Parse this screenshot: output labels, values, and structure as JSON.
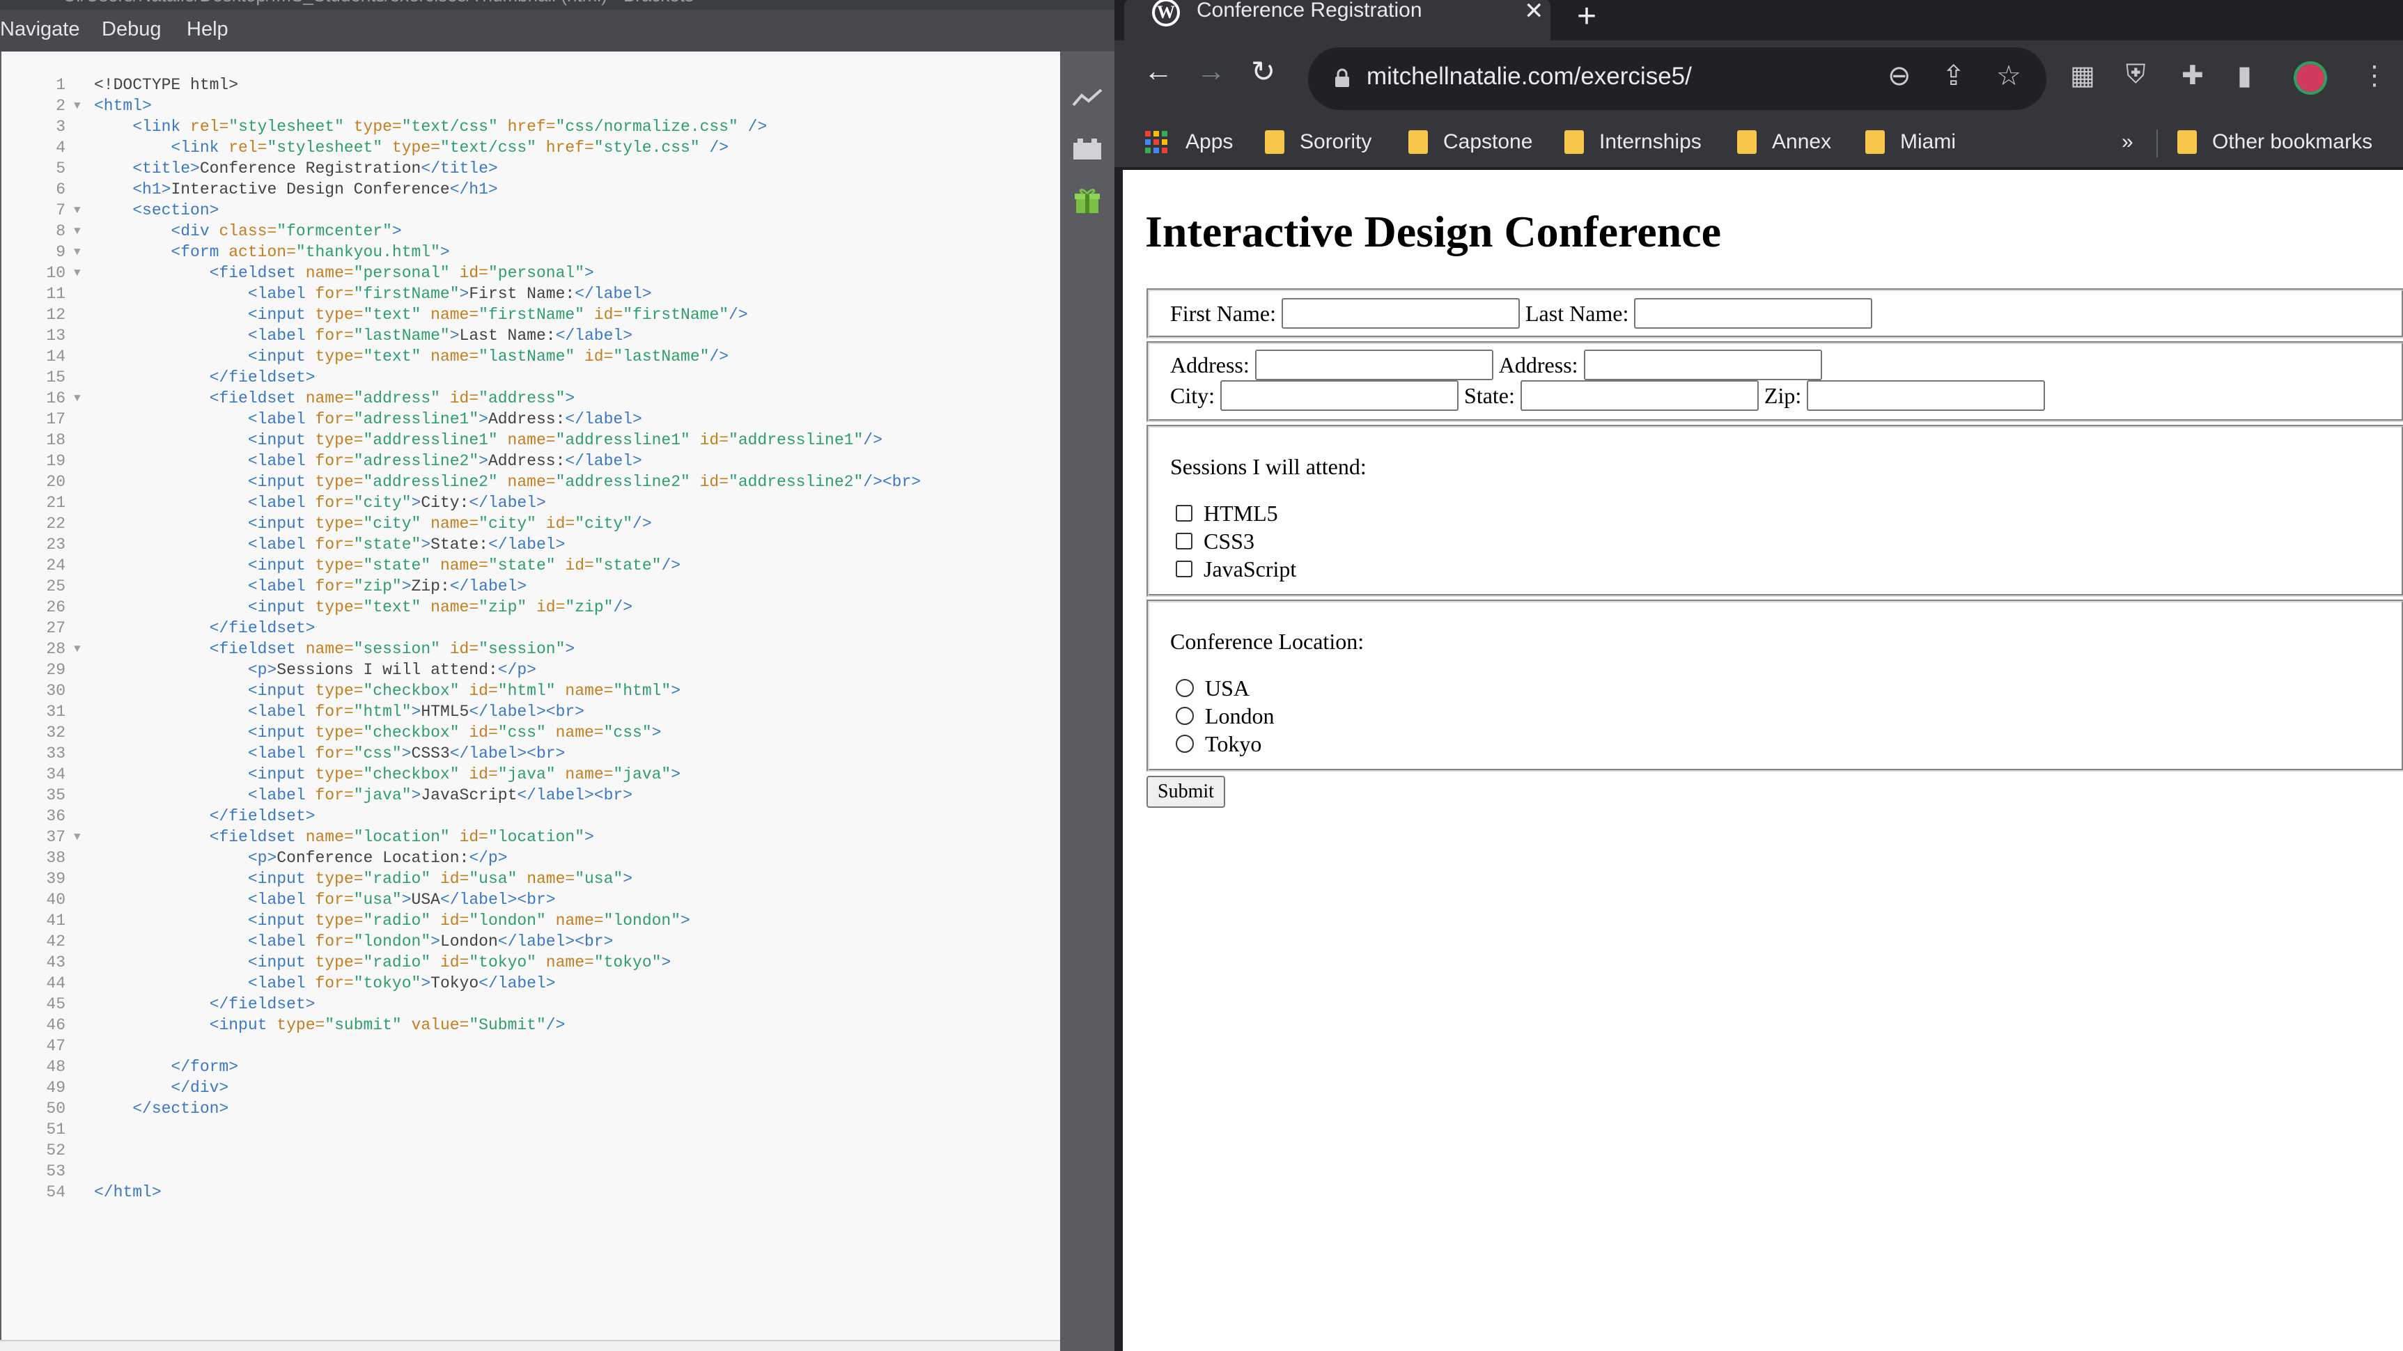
{
  "editor": {
    "title": "C:/Users/Natalie/Desktop/IMS_Students/exercises/Thumbnail (html) - Brackets",
    "menu": [
      "Navigate",
      "Debug",
      "Help"
    ],
    "lines": [
      {
        "n": "1",
        "fold": "",
        "html": "<span class='x'>&lt;!DOCTYPE html&gt;</span>"
      },
      {
        "n": "2",
        "fold": "▼",
        "html": "<span class='t'>&lt;html&gt;</span>"
      },
      {
        "n": "3",
        "fold": "",
        "html": "    <span class='t'>&lt;link</span> <span class='a'>rel=</span><span class='v'>\"stylesheet\"</span> <span class='a'>type=</span><span class='v'>\"text/css\"</span> <span class='a'>href=</span><span class='v'>\"css/normalize.css\"</span> <span class='t'>/&gt;</span>"
      },
      {
        "n": "4",
        "fold": "",
        "html": "        <span class='t'>&lt;link</span> <span class='a'>rel=</span><span class='v'>\"stylesheet\"</span> <span class='a'>type=</span><span class='v'>\"text/css\"</span> <span class='a'>href=</span><span class='v'>\"style.css\"</span> <span class='t'>/&gt;</span>"
      },
      {
        "n": "5",
        "fold": "",
        "html": "    <span class='t'>&lt;title&gt;</span><span class='x'>Conference Registration</span><span class='t'>&lt;/title&gt;</span>"
      },
      {
        "n": "6",
        "fold": "",
        "html": "    <span class='t'>&lt;h1&gt;</span><span class='x'>Interactive Design Conference</span><span class='t'>&lt;/h1&gt;</span>"
      },
      {
        "n": "7",
        "fold": "▼",
        "html": "    <span class='t'>&lt;section&gt;</span>"
      },
      {
        "n": "8",
        "fold": "▼",
        "html": "        <span class='t'>&lt;div</span> <span class='a'>class=</span><span class='v'>\"formcenter\"</span><span class='t'>&gt;</span>"
      },
      {
        "n": "9",
        "fold": "▼",
        "html": "        <span class='t'>&lt;form</span> <span class='a'>action=</span><span class='v'>\"thankyou.html\"</span><span class='t'>&gt;</span>"
      },
      {
        "n": "10",
        "fold": "▼",
        "html": "            <span class='t'>&lt;fieldset</span> <span class='a'>name=</span><span class='v'>\"personal\"</span> <span class='a'>id=</span><span class='v'>\"personal\"</span><span class='t'>&gt;</span>"
      },
      {
        "n": "11",
        "fold": "",
        "html": "                <span class='t'>&lt;label</span> <span class='a'>for=</span><span class='v'>\"firstName\"</span><span class='t'>&gt;</span><span class='x'>First Name:</span><span class='t'>&lt;/label&gt;</span>"
      },
      {
        "n": "12",
        "fold": "",
        "html": "                <span class='t'>&lt;input</span> <span class='a'>type=</span><span class='v'>\"text\"</span> <span class='a'>name=</span><span class='v'>\"firstName\"</span> <span class='a'>id=</span><span class='v'>\"firstName\"</span><span class='t'>/&gt;</span>"
      },
      {
        "n": "13",
        "fold": "",
        "html": "                <span class='t'>&lt;label</span> <span class='a'>for=</span><span class='v'>\"lastName\"</span><span class='t'>&gt;</span><span class='x'>Last Name:</span><span class='t'>&lt;/label&gt;</span>"
      },
      {
        "n": "14",
        "fold": "",
        "html": "                <span class='t'>&lt;input</span> <span class='a'>type=</span><span class='v'>\"text\"</span> <span class='a'>name=</span><span class='v'>\"lastName\"</span> <span class='a'>id=</span><span class='v'>\"lastName\"</span><span class='t'>/&gt;</span>"
      },
      {
        "n": "15",
        "fold": "",
        "html": "            <span class='t'>&lt;/fieldset&gt;</span>"
      },
      {
        "n": "16",
        "fold": "▼",
        "html": "            <span class='t'>&lt;fieldset</span> <span class='a'>name=</span><span class='v'>\"address\"</span> <span class='a'>id=</span><span class='v'>\"address\"</span><span class='t'>&gt;</span>"
      },
      {
        "n": "17",
        "fold": "",
        "html": "                <span class='t'>&lt;label</span> <span class='a'>for=</span><span class='v'>\"adressline1\"</span><span class='t'>&gt;</span><span class='x'>Address:</span><span class='t'>&lt;/label&gt;</span>"
      },
      {
        "n": "18",
        "fold": "",
        "html": "                <span class='t'>&lt;input</span> <span class='a'>type=</span><span class='v'>\"addressline1\"</span> <span class='a'>name=</span><span class='v'>\"addressline1\"</span> <span class='a'>id=</span><span class='v'>\"addressline1\"</span><span class='t'>/&gt;</span>"
      },
      {
        "n": "19",
        "fold": "",
        "html": "                <span class='t'>&lt;label</span> <span class='a'>for=</span><span class='v'>\"adressline2\"</span><span class='t'>&gt;</span><span class='x'>Address:</span><span class='t'>&lt;/label&gt;</span>"
      },
      {
        "n": "20",
        "fold": "",
        "html": "                <span class='t'>&lt;input</span> <span class='a'>type=</span><span class='v'>\"addressline2\"</span> <span class='a'>name=</span><span class='v'>\"addressline2\"</span> <span class='a'>id=</span><span class='v'>\"addressline2\"</span><span class='t'>/&gt;&lt;br&gt;</span>"
      },
      {
        "n": "21",
        "fold": "",
        "html": "                <span class='t'>&lt;label</span> <span class='a'>for=</span><span class='v'>\"city\"</span><span class='t'>&gt;</span><span class='x'>City:</span><span class='t'>&lt;/label&gt;</span>"
      },
      {
        "n": "22",
        "fold": "",
        "html": "                <span class='t'>&lt;input</span> <span class='a'>type=</span><span class='v'>\"city\"</span> <span class='a'>name=</span><span class='v'>\"city\"</span> <span class='a'>id=</span><span class='v'>\"city\"</span><span class='t'>/&gt;</span>"
      },
      {
        "n": "23",
        "fold": "",
        "html": "                <span class='t'>&lt;label</span> <span class='a'>for=</span><span class='v'>\"state\"</span><span class='t'>&gt;</span><span class='x'>State:</span><span class='t'>&lt;/label&gt;</span>"
      },
      {
        "n": "24",
        "fold": "",
        "html": "                <span class='t'>&lt;input</span> <span class='a'>type=</span><span class='v'>\"state\"</span> <span class='a'>name=</span><span class='v'>\"state\"</span> <span class='a'>id=</span><span class='v'>\"state\"</span><span class='t'>/&gt;</span>"
      },
      {
        "n": "25",
        "fold": "",
        "html": "                <span class='t'>&lt;label</span> <span class='a'>for=</span><span class='v'>\"zip\"</span><span class='t'>&gt;</span><span class='x'>Zip:</span><span class='t'>&lt;/label&gt;</span>"
      },
      {
        "n": "26",
        "fold": "",
        "html": "                <span class='t'>&lt;input</span> <span class='a'>type=</span><span class='v'>\"text\"</span> <span class='a'>name=</span><span class='v'>\"zip\"</span> <span class='a'>id=</span><span class='v'>\"zip\"</span><span class='t'>/&gt;</span>"
      },
      {
        "n": "27",
        "fold": "",
        "html": "            <span class='t'>&lt;/fieldset&gt;</span>"
      },
      {
        "n": "28",
        "fold": "▼",
        "html": "            <span class='t'>&lt;fieldset</span> <span class='a'>name=</span><span class='v'>\"session\"</span> <span class='a'>id=</span><span class='v'>\"session\"</span><span class='t'>&gt;</span>"
      },
      {
        "n": "29",
        "fold": "",
        "html": "                <span class='t'>&lt;p&gt;</span><span class='x'>Sessions I will attend:</span><span class='t'>&lt;/p&gt;</span>"
      },
      {
        "n": "30",
        "fold": "",
        "html": "                <span class='t'>&lt;input</span> <span class='a'>type=</span><span class='v'>\"checkbox\"</span> <span class='a'>id=</span><span class='v'>\"html\"</span> <span class='a'>name=</span><span class='v'>\"html\"</span><span class='t'>&gt;</span>"
      },
      {
        "n": "31",
        "fold": "",
        "html": "                <span class='t'>&lt;label</span> <span class='a'>for=</span><span class='v'>\"html\"</span><span class='t'>&gt;</span><span class='x'>HTML5</span><span class='t'>&lt;/label&gt;&lt;br&gt;</span>"
      },
      {
        "n": "32",
        "fold": "",
        "html": "                <span class='t'>&lt;input</span> <span class='a'>type=</span><span class='v'>\"checkbox\"</span> <span class='a'>id=</span><span class='v'>\"css\"</span> <span class='a'>name=</span><span class='v'>\"css\"</span><span class='t'>&gt;</span>"
      },
      {
        "n": "33",
        "fold": "",
        "html": "                <span class='t'>&lt;label</span> <span class='a'>for=</span><span class='v'>\"css\"</span><span class='t'>&gt;</span><span class='x'>CSS3</span><span class='t'>&lt;/label&gt;&lt;br&gt;</span>"
      },
      {
        "n": "34",
        "fold": "",
        "html": "                <span class='t'>&lt;input</span> <span class='a'>type=</span><span class='v'>\"checkbox\"</span> <span class='a'>id=</span><span class='v'>\"java\"</span> <span class='a'>name=</span><span class='v'>\"java\"</span><span class='t'>&gt;</span>"
      },
      {
        "n": "35",
        "fold": "",
        "html": "                <span class='t'>&lt;label</span> <span class='a'>for=</span><span class='v'>\"java\"</span><span class='t'>&gt;</span><span class='x'>JavaScript</span><span class='t'>&lt;/label&gt;&lt;br&gt;</span>"
      },
      {
        "n": "36",
        "fold": "",
        "html": "            <span class='t'>&lt;/fieldset&gt;</span>"
      },
      {
        "n": "37",
        "fold": "▼",
        "html": "            <span class='t'>&lt;fieldset</span> <span class='a'>name=</span><span class='v'>\"location\"</span> <span class='a'>id=</span><span class='v'>\"location\"</span><span class='t'>&gt;</span>"
      },
      {
        "n": "38",
        "fold": "",
        "html": "                <span class='t'>&lt;p&gt;</span><span class='x'>Conference Location:</span><span class='t'>&lt;/p&gt;</span>"
      },
      {
        "n": "39",
        "fold": "",
        "html": "                <span class='t'>&lt;input</span> <span class='a'>type=</span><span class='v'>\"radio\"</span> <span class='a'>id=</span><span class='v'>\"usa\"</span> <span class='a'>name=</span><span class='v'>\"usa\"</span><span class='t'>&gt;</span>"
      },
      {
        "n": "40",
        "fold": "",
        "html": "                <span class='t'>&lt;label</span> <span class='a'>for=</span><span class='v'>\"usa\"</span><span class='t'>&gt;</span><span class='x'>USA</span><span class='t'>&lt;/label&gt;&lt;br&gt;</span>"
      },
      {
        "n": "41",
        "fold": "",
        "html": "                <span class='t'>&lt;input</span> <span class='a'>type=</span><span class='v'>\"radio\"</span> <span class='a'>id=</span><span class='v'>\"london\"</span> <span class='a'>name=</span><span class='v'>\"london\"</span><span class='t'>&gt;</span>"
      },
      {
        "n": "42",
        "fold": "",
        "html": "                <span class='t'>&lt;label</span> <span class='a'>for=</span><span class='v'>\"london\"</span><span class='t'>&gt;</span><span class='x'>London</span><span class='t'>&lt;/label&gt;&lt;br&gt;</span>"
      },
      {
        "n": "43",
        "fold": "",
        "html": "                <span class='t'>&lt;input</span> <span class='a'>type=</span><span class='v'>\"radio\"</span> <span class='a'>id=</span><span class='v'>\"tokyo\"</span> <span class='a'>name=</span><span class='v'>\"tokyo\"</span><span class='t'>&gt;</span>"
      },
      {
        "n": "44",
        "fold": "",
        "html": "                <span class='t'>&lt;label</span> <span class='a'>for=</span><span class='v'>\"tokyo\"</span><span class='t'>&gt;</span><span class='x'>Tokyo</span><span class='t'>&lt;/label&gt;</span>"
      },
      {
        "n": "45",
        "fold": "",
        "html": "            <span class='t'>&lt;/fieldset&gt;</span>"
      },
      {
        "n": "46",
        "fold": "",
        "html": "            <span class='t'>&lt;input</span> <span class='a'>type=</span><span class='v'>\"submit\"</span> <span class='a'>value=</span><span class='v'>\"Submit\"</span><span class='t'>/&gt;</span>"
      },
      {
        "n": "47",
        "fold": "",
        "html": ""
      },
      {
        "n": "48",
        "fold": "",
        "html": "        <span class='t'>&lt;/form&gt;</span>"
      },
      {
        "n": "49",
        "fold": "",
        "html": "        <span class='t'>&lt;/div&gt;</span>"
      },
      {
        "n": "50",
        "fold": "",
        "html": "    <span class='t'>&lt;/section&gt;</span>"
      },
      {
        "n": "51",
        "fold": "",
        "html": ""
      },
      {
        "n": "52",
        "fold": "",
        "html": ""
      },
      {
        "n": "53",
        "fold": "",
        "html": ""
      },
      {
        "n": "54",
        "fold": "",
        "html": "<span class='t'>&lt;/html&gt;</span>"
      }
    ]
  },
  "browser": {
    "tab_title": "Conference Registration",
    "url": "mitchellnatalie.com/exercise5/",
    "bookmarks": [
      "Apps",
      "Sorority",
      "Capstone",
      "Internships",
      "Annex",
      "Miami"
    ],
    "overflow": "»",
    "other_bookmarks": "Other bookmarks"
  },
  "page": {
    "heading": "Interactive Design Conference",
    "first_name_label": "First Name:",
    "last_name_label": "Last Name:",
    "address1_label": "Address:",
    "address2_label": "Address:",
    "city_label": "City:",
    "state_label": "State:",
    "zip_label": "Zip:",
    "sessions_prompt": "Sessions I will attend:",
    "sessions": [
      "HTML5",
      "CSS3",
      "JavaScript"
    ],
    "location_prompt": "Conference Location:",
    "locations": [
      "USA",
      "London",
      "Tokyo"
    ],
    "submit_label": "Submit"
  },
  "colors": {
    "tag": "#3b78c4",
    "attribute": "#c47e1f",
    "string": "#2e9e6b",
    "folder": "#f6c64a"
  }
}
